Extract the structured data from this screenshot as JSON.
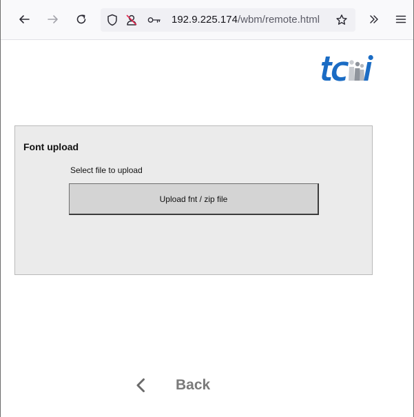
{
  "browser": {
    "url_host": "192.9.225.174",
    "url_path": "/wbm/remote.html",
    "icons": {
      "back": "arrow-left-icon",
      "forward": "arrow-right-icon",
      "reload": "reload-icon",
      "tracking": "shield-icon",
      "permissions": "camera-blocked-icon",
      "key": "key-icon",
      "bookmark": "star-icon",
      "overflow": "double-chevron-right-icon",
      "menu": "hamburger-menu-icon"
    }
  },
  "page": {
    "logo": "tci-logo",
    "logo_color": "#1b6cc4",
    "panel": {
      "title": "Font upload",
      "label": "Select file to upload",
      "button": "Upload fnt / zip file"
    },
    "back": {
      "label": "Back"
    }
  }
}
